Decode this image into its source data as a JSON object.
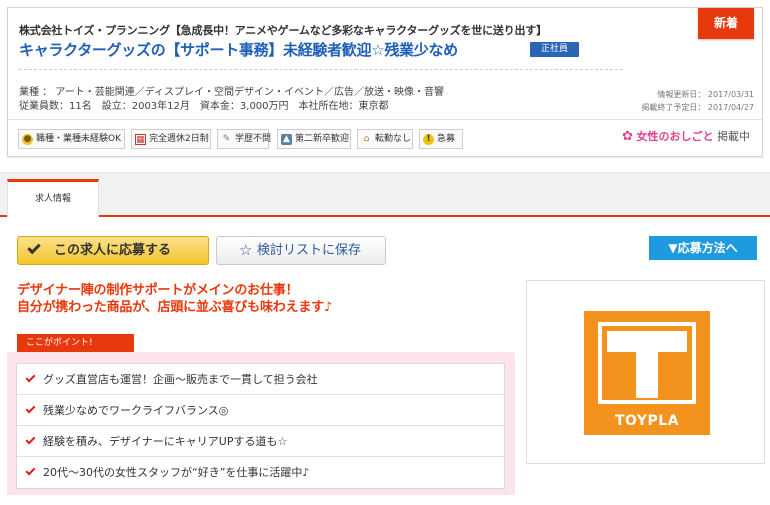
{
  "header": {
    "company": "株式会社トイズ・プランニング【急成長中！アニメやゲームなど多彩なキャラクターグッズを世に送り出す】",
    "job_title": "キャラクターグッズの【サポート事務】未経験者歓迎☆残業少なめ",
    "employment_badge": "正社員",
    "new_badge": "新着",
    "industry": "業種 ： アート・芸能関連／ディスプレイ・空間デザイン・イベント／広告／放送・映像・音響",
    "company_info": "従業員数：11名　設立：2003年12月　資本金：3,000万円　本社所在地：東京都",
    "updated": "情報更新日： 2017/03/31",
    "end_date": "掲載終了予定日： 2017/04/27"
  },
  "tags": [
    {
      "label": "職種・業種未経験OK",
      "icon": "shoe-icon"
    },
    {
      "label": "完全週休2日制",
      "icon": "calendar-icon"
    },
    {
      "label": "学歴不問",
      "icon": "pencil-icon"
    },
    {
      "label": "第二新卒歓迎",
      "icon": "person-icon"
    },
    {
      "label": "転勤なし",
      "icon": "house-icon"
    },
    {
      "label": "急募",
      "icon": "alert-icon"
    }
  ],
  "women": {
    "brand": "女性のおしごと",
    "post": "掲載中",
    "icon": "flower-icon",
    "color": "#e3418f"
  },
  "tabs": [
    {
      "label": "求人情報",
      "active": true
    }
  ],
  "actions": {
    "apply": "この求人に応募する",
    "save": "検討リストに保存",
    "how_to_apply": "▼応募方法へ"
  },
  "catch": {
    "line1": "デザイナー陣の制作サポートがメインのお仕事！",
    "line2": "自分が携わった商品が、店頭に並ぶ喜びも味わえます♪"
  },
  "points": {
    "label": "ここがポイント!",
    "items": [
      "グッズ直営店も運営！企画〜販売まで一貫して担う会社",
      "残業少なめでワークライフバランス◎",
      "経験を積み、デザイナーにキャリアUPする道も☆",
      "20代〜30代の女性スタッフが“好き”を仕事に活躍中♪"
    ]
  },
  "logo": {
    "text": "TOYPLA",
    "color": "#f3921c"
  },
  "colors": {
    "accent": "#e8380d",
    "title_blue": "#1f5fb8",
    "info_blue": "#1e9ae0",
    "apply_yellow": "#f4c52c",
    "point_bg": "#fde3ea"
  }
}
